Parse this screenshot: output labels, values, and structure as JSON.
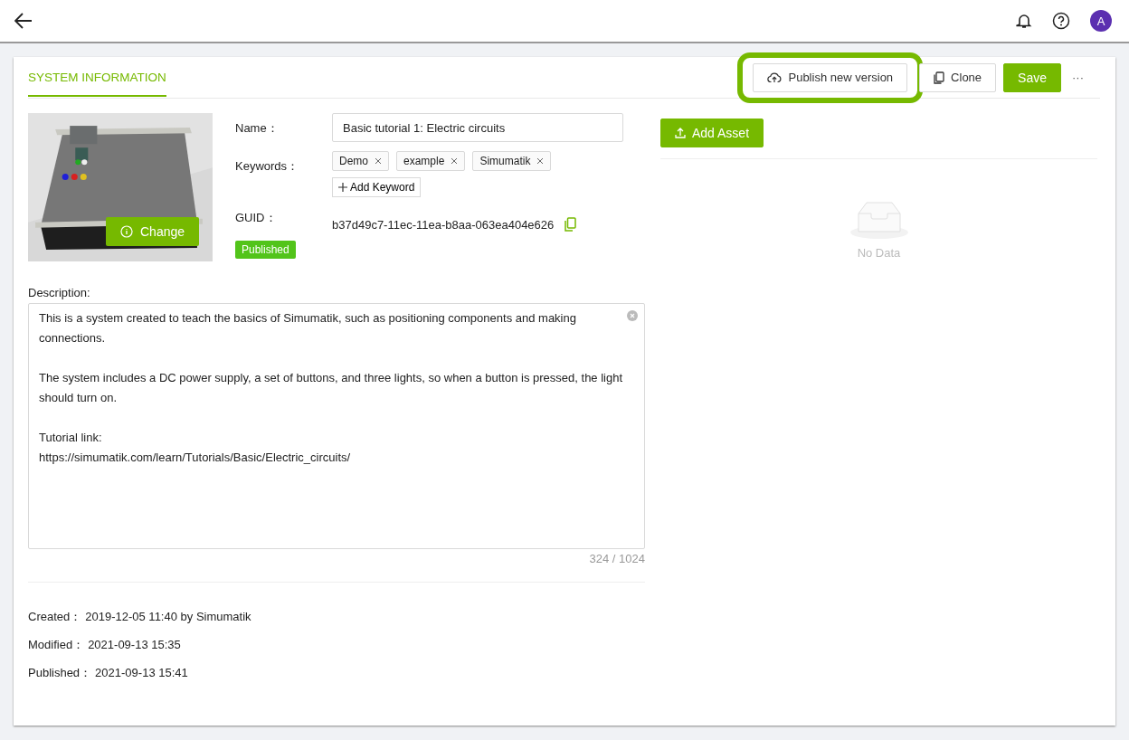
{
  "header": {
    "avatar": "A"
  },
  "tabs": [
    {
      "label": "SYSTEM INFORMATION",
      "selected": true
    }
  ],
  "actions": [
    {
      "kind": "publish",
      "label": "Publish new version",
      "highlighted": true
    },
    {
      "kind": "clone",
      "label": "Clone",
      "highlighted": false
    },
    {
      "kind": "primary",
      "label": "Save",
      "highlighted": false
    },
    {
      "kind": "more",
      "label": "···",
      "highlighted": false
    }
  ],
  "thumbnail": {
    "button": "Change"
  },
  "name": {
    "label": "Name：",
    "value": "Basic tutorial 1: Electric circuits"
  },
  "keywords": {
    "label": "Keywords：",
    "tags": [
      "Demo",
      "example",
      "Simumatik"
    ],
    "add": "Add Keyword"
  },
  "guid": {
    "label": "GUID：",
    "value": "b37d49c7-11ec-11ea-b8aa-063ea404e626"
  },
  "status": "Published",
  "description": {
    "label": "Description:",
    "paragraphs": [
      "This is a system created to teach the basics of Simumatik, such as positioning components and making connections.",
      "The system includes a DC power supply, a set of buttons, and three lights, so when a button is pressed, the light should turn on.",
      "Tutorial link:\nhttps://simumatik.com/learn/Tutorials/Basic/Electric_circuits/"
    ],
    "counter": "324 / 1024"
  },
  "meta": [
    {
      "label": "Created：",
      "value": "2019-12-05 11:40 by Simumatik"
    },
    {
      "label": "Modified：",
      "value": "2021-09-13 15:35"
    },
    {
      "label": "Published：",
      "value": "2021-09-13 15:41"
    }
  ],
  "assets": {
    "button": "Add Asset",
    "empty": "No Data"
  }
}
